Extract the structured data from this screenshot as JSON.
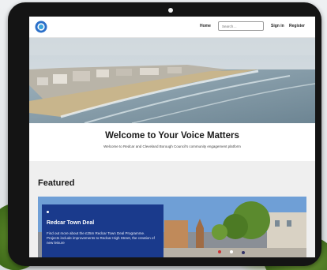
{
  "header": {
    "logo_icon": "speech-bubble-logo-icon",
    "nav_home": "Home",
    "search_placeholder": "Search…",
    "nav_signin": "Sign in",
    "nav_register": "Register"
  },
  "hero": {
    "title": "Welcome to Your Voice Matters",
    "subtitle": "Welcome to Redcar and Cleveland Borough Council's community engagement platform"
  },
  "featured": {
    "heading": "Featured",
    "card": {
      "title": "Redcar Town Deal",
      "text": "Find out more about the £25m Redcar Town Deal Programme. Projects include improvements to Redcar High Street, the creation of new leisure"
    }
  },
  "colors": {
    "card_bg": "#1a3a8c",
    "logo_blue": "#2a6fc9"
  }
}
